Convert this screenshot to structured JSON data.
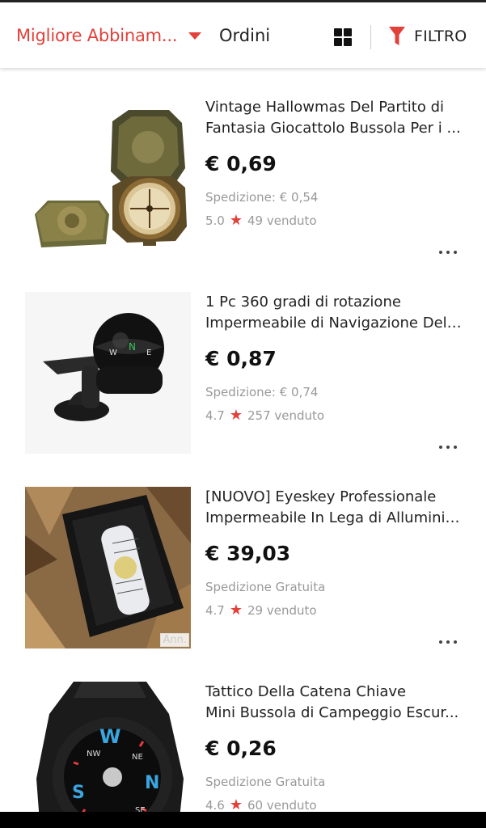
{
  "toolbar": {
    "sort_label": "Migliore Abbinam...",
    "orders_label": "Ordini",
    "filter_label": "FILTRO"
  },
  "products": [
    {
      "title_line1": "Vintage Hallowmas Del Partito di",
      "title_line2": "Fantasia Giocattolo Bussola Per i ...",
      "price": "€ 0,69",
      "shipping": "Spedizione: € 0,54",
      "rating": "5.0",
      "sold": "49 venduto"
    },
    {
      "title_line1": "1 Pc 360 gradi di rotazione",
      "title_line2": "Impermeabile di Navigazione Del ...",
      "price": "€ 0,87",
      "shipping": "Spedizione: € 0,74",
      "rating": "4.7",
      "sold": "257 venduto"
    },
    {
      "title_line1": "[NUOVO] Eyeskey Professionale",
      "title_line2": "Impermeabile In Lega di Alluminio...",
      "price": "€ 39,03",
      "shipping": "Spedizione Gratuita",
      "rating": "4.7",
      "sold": "29 venduto",
      "ad_label": "Ann."
    },
    {
      "title_line1": "Tattico Della Catena Chiave",
      "title_line2": "Mini Bussola di Campeggio Escur...",
      "price": "€ 0,26",
      "shipping": "Spedizione Gratuita",
      "rating": "4.6",
      "sold": "60 venduto"
    }
  ],
  "colors": {
    "accent": "#e3403a",
    "text": "#222222",
    "muted": "#999999"
  },
  "icons": [
    "chevron-down-icon",
    "grid-view-icon",
    "filter-icon",
    "star-icon",
    "more-icon"
  ]
}
